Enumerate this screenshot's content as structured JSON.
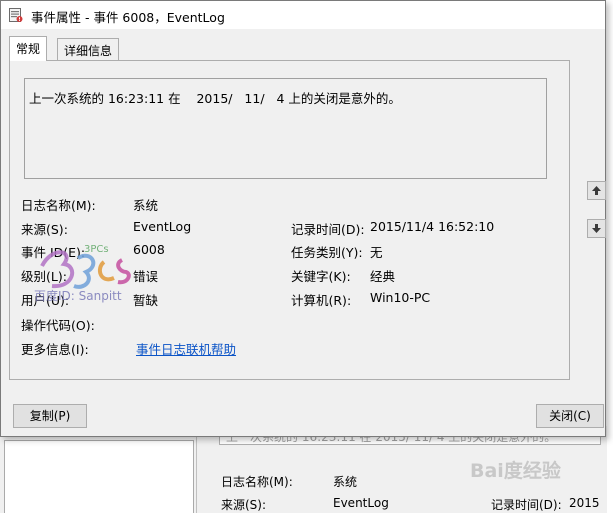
{
  "titlebar": {
    "title": "事件属性 - 事件 6008，EventLog"
  },
  "tabs": [
    {
      "label": "常规",
      "active": true
    },
    {
      "label": "详细信息",
      "active": false
    }
  ],
  "description": "上一次系统的 16:23:11 在    2015/   11/   4 上的关闭是意外的。",
  "fields": {
    "log_name_label": "日志名称(M):",
    "log_name_value": "系统",
    "source_label": "来源(S):",
    "source_value": "EventLog",
    "logged_label": "记录时间(D):",
    "logged_value": "2015/11/4 16:52:10",
    "event_id_label": "事件 ID(E):",
    "event_id_value": "6008",
    "task_category_label": "任务类别(Y):",
    "task_category_value": "无",
    "level_label": "级别(L):",
    "level_value": "错误",
    "keywords_label": "关键字(K):",
    "keywords_value": "经典",
    "user_label": "用户(U):",
    "user_value": "暂缺",
    "computer_label": "计算机(R):",
    "computer_value": "Win10-PC",
    "opcode_label": "操作代码(O):",
    "more_info_label": "更多信息(I):",
    "more_info_link": "事件日志联机帮助"
  },
  "buttons": {
    "copy": "复制(P)",
    "close": "关闭(C)"
  },
  "watermark": {
    "text": "百度ID: Sanpitt",
    "logo_text": "3PCs"
  },
  "background_window": {
    "desc_fragment": "上一次系统的 16:23:11 在    2015/   11/   4 上的关闭是意外的。",
    "log_name_label": "日志名称(M):",
    "log_name_value": "系统",
    "source_label": "来源(S):",
    "source_value": "EventLog",
    "logged_label": "记录时间(D):",
    "logged_value": "2015"
  },
  "baidu_watermark": "Bai度经验",
  "colors": {
    "link": "#0b54c7",
    "dialog_bg": "#f0f0f0",
    "title_bg": "#ffffff"
  }
}
